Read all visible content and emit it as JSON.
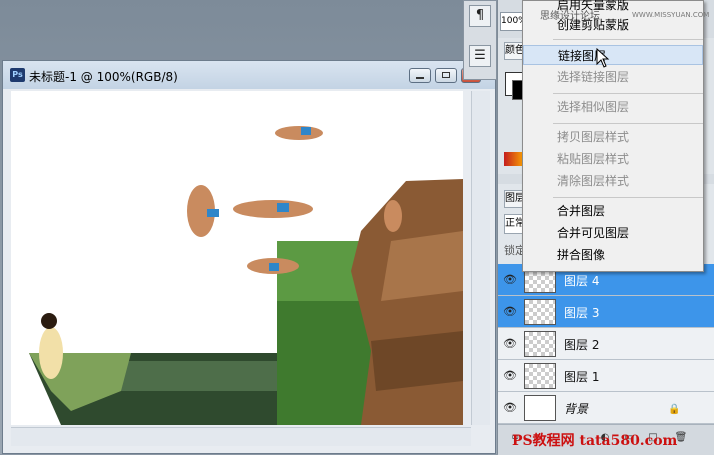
{
  "document": {
    "title": "未标题-1 @ 100%(RGB/8)",
    "app_badge": "Ps"
  },
  "toolbar": {
    "zoom_value": "100%",
    "paragraph_icon": "pilcrow-icon",
    "layers_icon": "list-panel-icon"
  },
  "panels": {
    "color_tab": "颜色",
    "layers_tab": "图层",
    "blend_mode": "正常",
    "lock_label": "锁定"
  },
  "layers": [
    {
      "name": "图层 4",
      "selected": true,
      "thumb": "transparent"
    },
    {
      "name": "图层 3",
      "selected": true,
      "thumb": "transparent"
    },
    {
      "name": "图层 2",
      "selected": false,
      "thumb": "transparent"
    },
    {
      "name": "图层 1",
      "selected": false,
      "thumb": "transparent"
    },
    {
      "name": "背景",
      "selected": false,
      "thumb": "white",
      "locked": true
    }
  ],
  "context_menu": {
    "items": [
      {
        "label": "启用矢量蒙版",
        "disabled": false
      },
      {
        "label": "创建剪贴蒙版",
        "disabled": false
      },
      {
        "label": "链接图层",
        "disabled": false,
        "highlighted": true
      },
      {
        "label": "选择链接图层",
        "disabled": true
      },
      {
        "label": "选择相似图层",
        "disabled": true
      },
      {
        "label": "拷贝图层样式",
        "disabled": true
      },
      {
        "label": "粘贴图层样式",
        "disabled": true
      },
      {
        "label": "清除图层样式",
        "disabled": true
      },
      {
        "label": "合并图层",
        "disabled": false
      },
      {
        "label": "合并可见图层",
        "disabled": false
      },
      {
        "label": "拼合图像",
        "disabled": false
      }
    ]
  },
  "watermarks": {
    "top": "思缘设计论坛",
    "top_url": "WWW.MISSYUAN.COM",
    "bottom": "PS教程网 tata580.com"
  },
  "colors": {
    "selection": "#3d95ea",
    "menu_bg": "#f0f0f0",
    "watermark_red": "#cc1010"
  }
}
